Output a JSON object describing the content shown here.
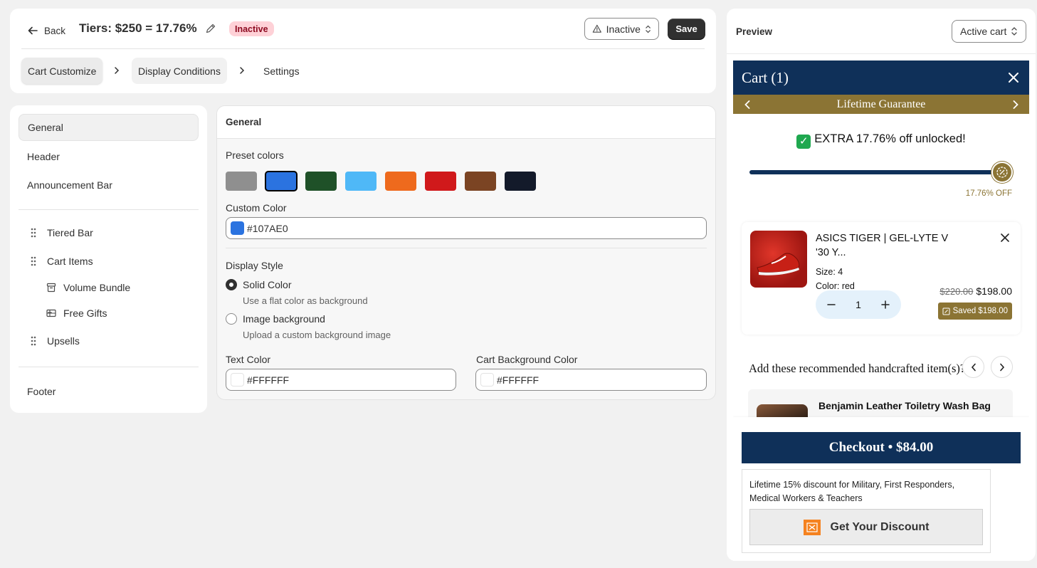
{
  "topbar": {
    "back_label": "Back",
    "title": "Tiers: $250 = 17.76%",
    "status_badge": "Inactive",
    "status_select": "Inactive",
    "save_label": "Save",
    "steps": [
      "Cart Customize",
      "Display Conditions",
      "Settings"
    ]
  },
  "sidebar": {
    "items": {
      "general": "General",
      "header": "Header",
      "announcement": "Announcement Bar",
      "tiered_bar": "Tiered Bar",
      "cart_items": "Cart Items",
      "volume_bundle": "Volume Bundle",
      "free_gifts": "Free Gifts",
      "upsells": "Upsells",
      "footer": "Footer"
    }
  },
  "editor": {
    "title": "General",
    "preset_label": "Preset colors",
    "preset_colors": [
      "#8f8f8f",
      "#2b73e0",
      "#1f5128",
      "#4fb8f7",
      "#ee6a1d",
      "#d0191b",
      "#7b4423",
      "#131a2a"
    ],
    "custom_color_label": "Custom Color",
    "custom_color_value": "#107AE0",
    "custom_color_swatch": "#2b73e0",
    "display_style_label": "Display Style",
    "solid_label": "Solid Color",
    "solid_hint": "Use a flat color as background",
    "image_label": "Image background",
    "image_hint": "Upload a custom background image",
    "text_color_label": "Text Color",
    "text_color_value": "#FFFFFF",
    "cart_bg_label": "Cart Background Color",
    "cart_bg_value": "#FFFFFF"
  },
  "preview": {
    "title": "Preview",
    "select": "Active cart",
    "cart": {
      "header": "Cart (1)",
      "announcement": "Lifetime Guarantee",
      "unlock_text": "EXTRA 17.76% off unlocked!",
      "progress": 1.0,
      "progress_label": "17.76% OFF",
      "item": {
        "name": "ASICS TIGER | GEL-LYTE V '30 Y...",
        "size": "Size: 4",
        "color": "Color: red",
        "qty": "1",
        "old_price": "$220.00",
        "price": "$198.00",
        "saved": "Saved $198.00"
      },
      "rec_title": "Add these recommended handcrafted item(s)?",
      "rec_item": "Benjamin Leather Toiletry Wash Bag",
      "checkout": "Checkout • $84.00",
      "promo_text": "Lifetime 15% discount for Military, First Responders, Medical Workers & Teachers",
      "promo_button": "Get Your Discount"
    },
    "colors": {
      "navy": "#0f3059",
      "gold": "#8b7434"
    }
  }
}
